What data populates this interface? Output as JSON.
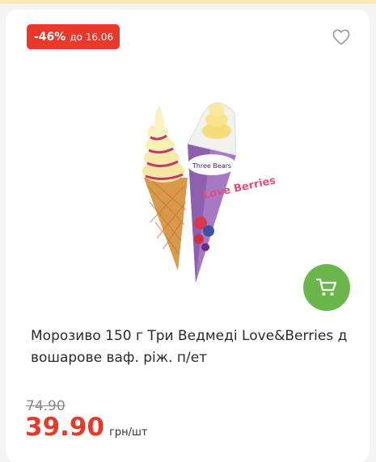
{
  "discount": {
    "percent_label": "-46%",
    "until_label": "до 16.06",
    "color": "#e8392b"
  },
  "product": {
    "title": "Морозиво 150 г Три Ведмеді Love&Berries д вошарове ваф. ріж. п/ет",
    "image_brand": "Three Bears",
    "image_line": "Love Berries"
  },
  "pricing": {
    "old_price": "74.90",
    "price": "39.90",
    "unit": "грн/шт"
  },
  "icons": {
    "favorite": "heart-outline-icon",
    "cart": "cart-icon"
  },
  "colors": {
    "accent_red": "#e8392b",
    "cart_green": "#6ab64a"
  }
}
